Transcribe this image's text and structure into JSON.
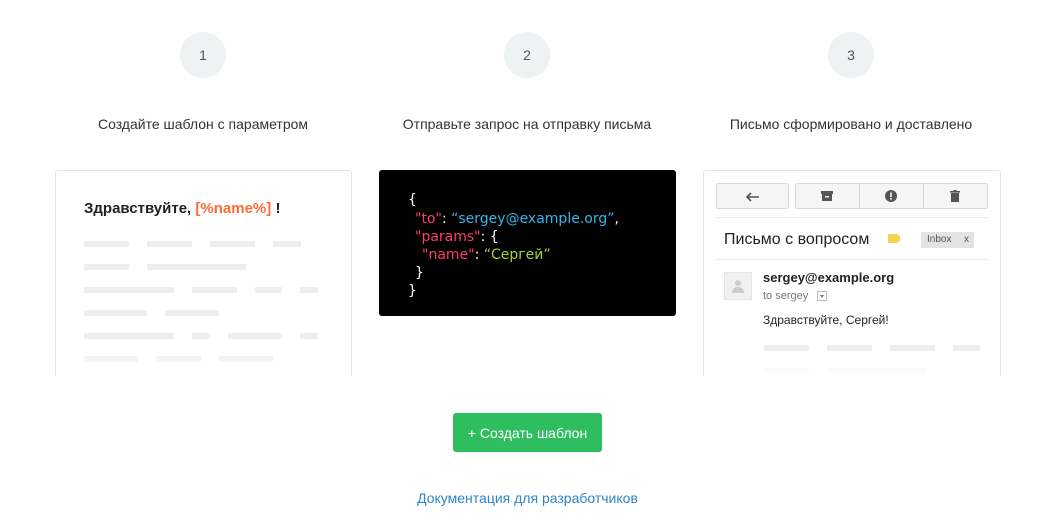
{
  "steps": [
    {
      "number": "1",
      "title": "Создайте шаблон с параметром"
    },
    {
      "number": "2",
      "title": "Отправьте запрос на отправку письма"
    },
    {
      "number": "3",
      "title": "Письмо сформировано и доставлено"
    }
  ],
  "template_card": {
    "greeting": "Здравствуйте,",
    "param": "[%name%]",
    "exclamation": "!"
  },
  "code_card": {
    "open_brace": "{",
    "to_key": "\"to\"",
    "to_value": "“sergey@example.org”",
    "params_key": "\"params\"",
    "params_open": ": {",
    "name_key": "\"name\"",
    "name_value": "“Сергей”",
    "inner_close": "}",
    "close_brace": "}"
  },
  "mail_card": {
    "subject": "Письмо с вопросом",
    "inbox_label": "Inbox",
    "inbox_close": "x",
    "sender": "sergey@example.org",
    "to_line": "to sergey",
    "body": "Здравствуйте, Сергей!",
    "icons": [
      "reply-icon",
      "archive-icon",
      "spam-icon",
      "trash-icon"
    ]
  },
  "actions": {
    "create_template": "+ Создать шаблон",
    "docs_link": "Документация для разработчиков"
  },
  "colors": {
    "accent_green": "#2ebe60",
    "param_orange": "#ff6b35",
    "link_blue": "#2f86c9",
    "code_pink": "#ff3d6a",
    "code_blue": "#35b6e8",
    "code_green": "#a6d23a"
  }
}
